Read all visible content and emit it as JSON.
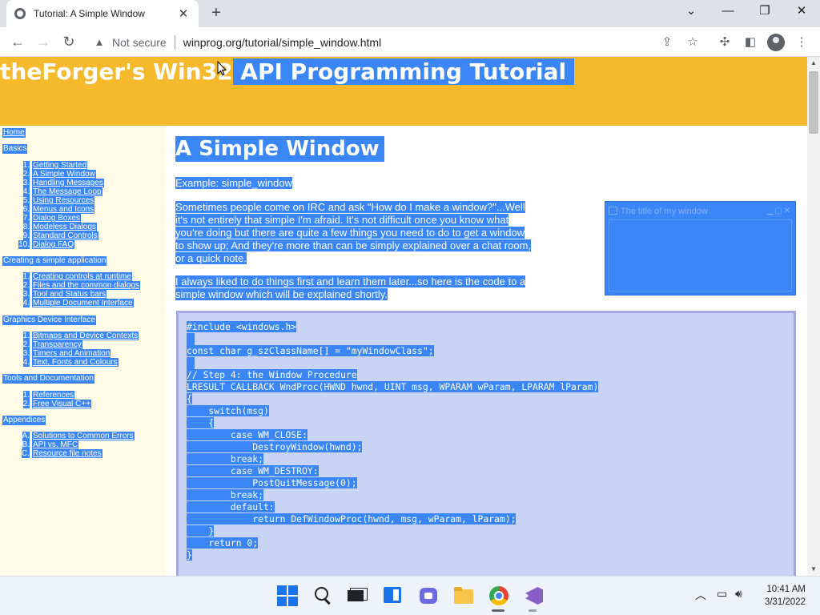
{
  "browser": {
    "tab_title": "Tutorial: A Simple Window",
    "tab_close": "✕",
    "new_tab": "+",
    "not_secure": "Not secure",
    "url": "winprog.org/tutorial/simple_window.html"
  },
  "banner": {
    "title_unselected": "theForger's Win32",
    "title_selected": " API Programming Tutorial"
  },
  "sidebar": {
    "home": "Home",
    "basics": {
      "heading": "Basics",
      "items": [
        {
          "num": "1.",
          "label": "Getting Started"
        },
        {
          "num": "2.",
          "label": "A Simple Window"
        },
        {
          "num": "3.",
          "label": "Handling Messages"
        },
        {
          "num": "4.",
          "label": "The Message Loop"
        },
        {
          "num": "5.",
          "label": "Using Resources"
        },
        {
          "num": "6.",
          "label": "Menus and Icons"
        },
        {
          "num": "7.",
          "label": "Dialog Boxes"
        },
        {
          "num": "8.",
          "label": "Modeless Dialogs"
        },
        {
          "num": "9.",
          "label": "Standard Controls"
        },
        {
          "num": "10.",
          "label": "Dialog FAQ"
        }
      ]
    },
    "simple_app": {
      "heading": "Creating a simple application",
      "items": [
        {
          "num": "1.",
          "label": "Creating controls at runtime"
        },
        {
          "num": "2.",
          "label": "Files and the common dialogs"
        },
        {
          "num": "3.",
          "label": "Tool and Status bars"
        },
        {
          "num": "4.",
          "label": "Multiple Document Interface"
        }
      ]
    },
    "gdi": {
      "heading": "Graphics Device Interface",
      "items": [
        {
          "num": "1.",
          "label": "Bitmaps and Device Contexts"
        },
        {
          "num": "2.",
          "label": "Transparency"
        },
        {
          "num": "3.",
          "label": "Timers and Animation"
        },
        {
          "num": "4.",
          "label": "Text, Fonts and Colours"
        }
      ]
    },
    "tools": {
      "heading": "Tools and Documentation",
      "items": [
        {
          "num": "1.",
          "label": "References"
        },
        {
          "num": "2.",
          "label": "Free Visual C++"
        }
      ]
    },
    "appendices": {
      "heading": "Appendices",
      "items": [
        {
          "num": "A.",
          "label": "Solutions to Common Errors"
        },
        {
          "num": "B.",
          "label": "API vs. MFC"
        },
        {
          "num": "C.",
          "label": "Resource file notes"
        }
      ]
    }
  },
  "content": {
    "heading": "A Simple Window",
    "example": "Example: simple_window",
    "para1": [
      "Sometimes people come on IRC and ask \"How do I make a window?\"...Well",
      "it's not entirely that simple I'm afraid. It's not difficult once you know what",
      "you're doing but there are quite a few things you need to do to get a window",
      "to show up; And they're more than can be simply explained over a chat room,",
      "or a quick note."
    ],
    "para2": [
      "I always liked to do things first and learn them later...so here is the code to a",
      "simple window which will be explained shortly."
    ],
    "demo_window_title": "The title of my window",
    "code": [
      "#include <windows.h>",
      "",
      "const char g_szClassName[] = \"myWindowClass\";",
      "",
      "// Step 4: the Window Procedure",
      "LRESULT CALLBACK WndProc(HWND hwnd, UINT msg, WPARAM wParam, LPARAM lParam)",
      "{",
      "    switch(msg)",
      "    {",
      "        case WM_CLOSE:",
      "            DestroyWindow(hwnd);",
      "        break;",
      "        case WM_DESTROY:",
      "            PostQuitMessage(0);",
      "        break;",
      "        default:",
      "            return DefWindowProc(hwnd, msg, wParam, lParam);",
      "    }",
      "    return 0;",
      "}"
    ]
  },
  "taskbar": {
    "time": "10:41 AM",
    "date": "3/31/2022"
  },
  "colors": {
    "banner": "#f6b92b",
    "selection": "#3a86f7",
    "sidebar_bg": "#fffbe6",
    "code_bg": "#c9d4f4"
  }
}
